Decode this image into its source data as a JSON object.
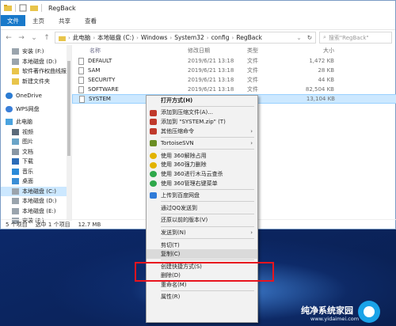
{
  "window": {
    "title": "RegBack",
    "ribbon_tabs": [
      "文件",
      "主页",
      "共享",
      "查看"
    ]
  },
  "address": {
    "crumbs": [
      "此电脑",
      "本地磁盘 (C:)",
      "Windows",
      "System32",
      "config",
      "RegBack"
    ],
    "search_placeholder": "搜索\"RegBack\""
  },
  "sidebar": {
    "items": [
      {
        "label": "安装 (F:)",
        "icon": "drive-icon"
      },
      {
        "label": "本地磁盘 (D:)",
        "icon": "drive-icon"
      },
      {
        "label": "软件著作权曲线报",
        "icon": "folder-icon"
      },
      {
        "label": "新建文件夹",
        "icon": "folder-icon"
      },
      {
        "label": "OneDrive",
        "icon": "cloud-icon"
      },
      {
        "label": "WPS网盘",
        "icon": "cloud-icon"
      },
      {
        "label": "此电脑",
        "icon": "computer-icon"
      },
      {
        "label": "视频",
        "icon": "video-icon"
      },
      {
        "label": "图片",
        "icon": "picture-icon"
      },
      {
        "label": "文档",
        "icon": "document-icon"
      },
      {
        "label": "下载",
        "icon": "download-icon"
      },
      {
        "label": "音乐",
        "icon": "music-icon"
      },
      {
        "label": "桌面",
        "icon": "desktop-icon"
      },
      {
        "label": "本地磁盘 (C:)",
        "icon": "drive-icon"
      },
      {
        "label": "本地磁盘 (D:)",
        "icon": "drive-icon"
      },
      {
        "label": "本地磁盘 (E:)",
        "icon": "drive-icon"
      },
      {
        "label": "安装 (F:)",
        "icon": "drive-icon"
      }
    ]
  },
  "files": {
    "headers": {
      "name": "名称",
      "date": "修改日期",
      "type": "类型",
      "size": "大小"
    },
    "rows": [
      {
        "name": "DEFAULT",
        "date": "2019/6/21 13:18",
        "type": "文件",
        "size": "1,472 KB"
      },
      {
        "name": "SAM",
        "date": "2019/6/21 13:18",
        "type": "文件",
        "size": "28 KB"
      },
      {
        "name": "SECURITY",
        "date": "2019/6/21 13:18",
        "type": "文件",
        "size": "44 KB"
      },
      {
        "name": "SOFTWARE",
        "date": "2019/6/21 13:18",
        "type": "文件",
        "size": "82,504 KB"
      },
      {
        "name": "SYSTEM",
        "date": "",
        "type": "",
        "size": "13,104 KB"
      }
    ]
  },
  "status": {
    "count": "5 个项目",
    "selected": "选中 1 个项目",
    "size": "12.7 MB"
  },
  "context_menu": {
    "groups": [
      [
        {
          "label": "打开方式(H)",
          "bold": true
        }
      ],
      [
        {
          "label": "添加到压缩文件(A)...",
          "icon": "archive-icon",
          "color": "#c0392b"
        },
        {
          "label": "添加到 \"SYSTEM.zip\" (T)",
          "icon": "archive-icon",
          "color": "#c0392b"
        },
        {
          "label": "其他压缩命令",
          "icon": "archive-icon",
          "color": "#c0392b",
          "submenu": true
        }
      ],
      [
        {
          "label": "TortoiseSVN",
          "icon": "tortoise-icon",
          "color": "#6b8e23",
          "submenu": true
        }
      ],
      [
        {
          "label": "使用 360解除占用",
          "icon": "360-icon",
          "color": "#e2b300"
        },
        {
          "label": "使用 360强力删除",
          "icon": "360-icon",
          "color": "#e2b300"
        },
        {
          "label": "使用 360进行木马云查杀",
          "icon": "360-green-icon",
          "color": "#2ea84a"
        },
        {
          "label": "使用 360管理右键菜单",
          "icon": "360-green-icon",
          "color": "#2ea84a"
        }
      ],
      [
        {
          "label": "上传到百度网盘",
          "icon": "baidu-cloud-icon",
          "color": "#2f7bd8"
        }
      ],
      [
        {
          "label": "通过QQ发送到"
        }
      ],
      [
        {
          "label": "还原以前的版本(V)"
        }
      ],
      [
        {
          "label": "发送到(N)",
          "submenu": true
        }
      ],
      [
        {
          "label": "剪切(T)"
        },
        {
          "label": "复制(C)",
          "highlight": true
        }
      ],
      [
        {
          "label": "创建快捷方式(S)"
        },
        {
          "label": "删除(D)"
        },
        {
          "label": "重命名(M)"
        }
      ],
      [
        {
          "label": "属性(R)"
        }
      ]
    ]
  },
  "watermark": {
    "text": "纯净系统家园",
    "url": "www.yidaimei.com"
  }
}
